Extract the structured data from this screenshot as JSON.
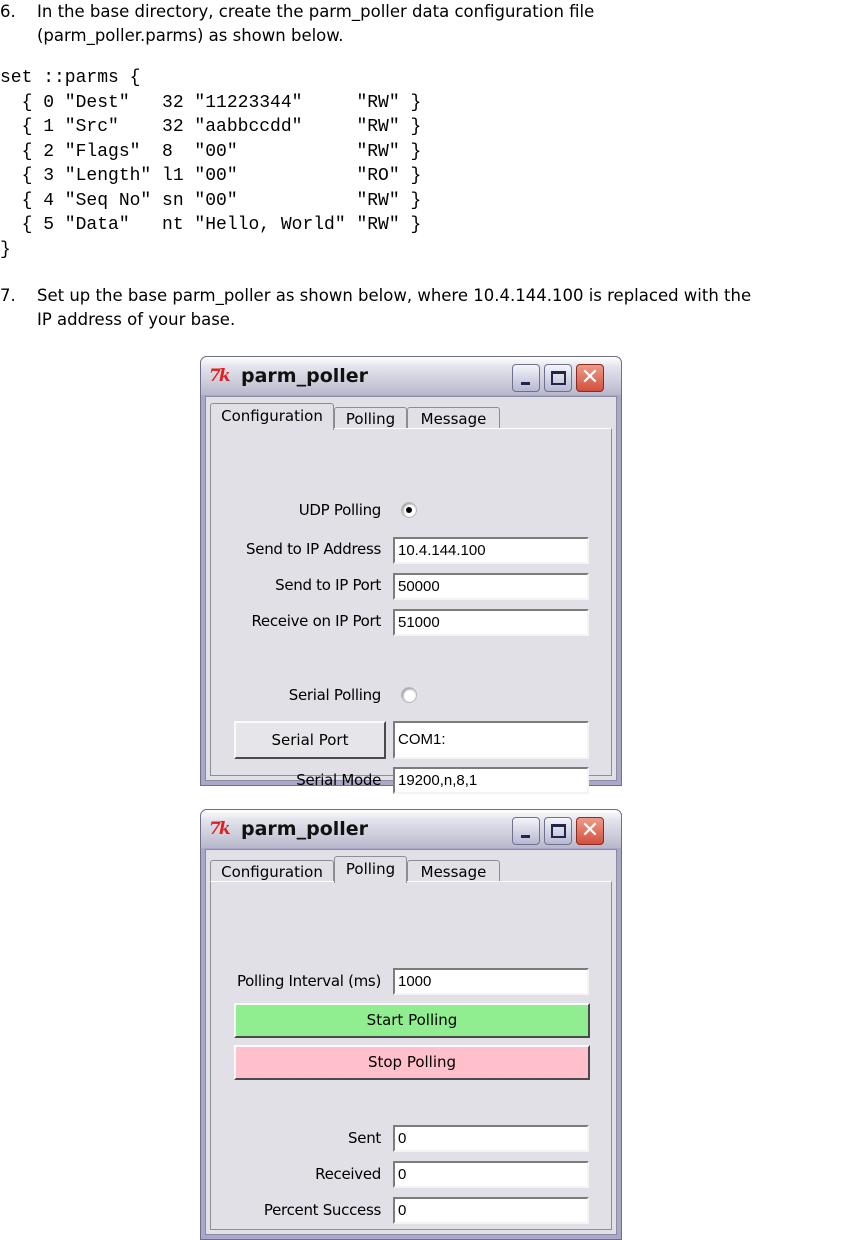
{
  "steps": [
    {
      "number": "6.",
      "lines": [
        "In the base directory, create the parm_poller data configuration file",
        "(parm_poller.parms) as shown below."
      ]
    },
    {
      "number": "7.",
      "lines": [
        "Set up the base parm_poller as shown below, where 10.4.144.100 is replaced with the",
        "IP address of your base."
      ]
    }
  ],
  "code_block": "set ::parms {\n  { 0 \"Dest\"   32 \"11223344\"     \"RW\" }\n  { 1 \"Src\"    32 \"aabbccdd\"     \"RW\" }\n  { 2 \"Flags\"  8  \"00\"           \"RW\" }\n  { 3 \"Length\" l1 \"00\"           \"RO\" }\n  { 4 \"Seq No\" sn \"00\"           \"RW\" }\n  { 5 \"Data\"   nt \"Hello, World\" \"RW\" }\n}",
  "windows": [
    {
      "title": "parm_poller",
      "app_icon": "tk-feather-icon",
      "tabs": [
        "Configuration",
        "Polling",
        "Message"
      ],
      "active_tab": "Configuration",
      "config": {
        "udp_polling_label": "UDP Polling",
        "udp_polling_selected": true,
        "send_ip_label": "Send to IP Address",
        "send_ip_value": "10.4.144.100",
        "send_port_label": "Send to IP Port",
        "send_port_value": "50000",
        "recv_port_label": "Receive on IP Port",
        "recv_port_value": "51000",
        "serial_polling_label": "Serial Polling",
        "serial_polling_selected": false,
        "serial_port_button": "Serial Port",
        "serial_port_value": "COM1:",
        "serial_mode_label": "Serial Mode",
        "serial_mode_value": "19200,n,8,1"
      }
    },
    {
      "title": "parm_poller",
      "app_icon": "tk-feather-icon",
      "tabs": [
        "Configuration",
        "Polling",
        "Message"
      ],
      "active_tab": "Polling",
      "polling": {
        "interval_label": "Polling Interval (ms)",
        "interval_value": "1000",
        "start_button": "Start Polling",
        "stop_button": "Stop Polling",
        "sent_label": "Sent",
        "sent_value": "0",
        "received_label": "Received",
        "received_value": "0",
        "percent_label": "Percent Success",
        "percent_value": "0"
      }
    }
  ],
  "colors": {
    "start_button_bg": "#90ee90",
    "stop_button_bg": "#ffc0cb",
    "window_bg": "#e1e0e6",
    "close_button": "#d2503e",
    "tk_icon": "#e0201c"
  }
}
